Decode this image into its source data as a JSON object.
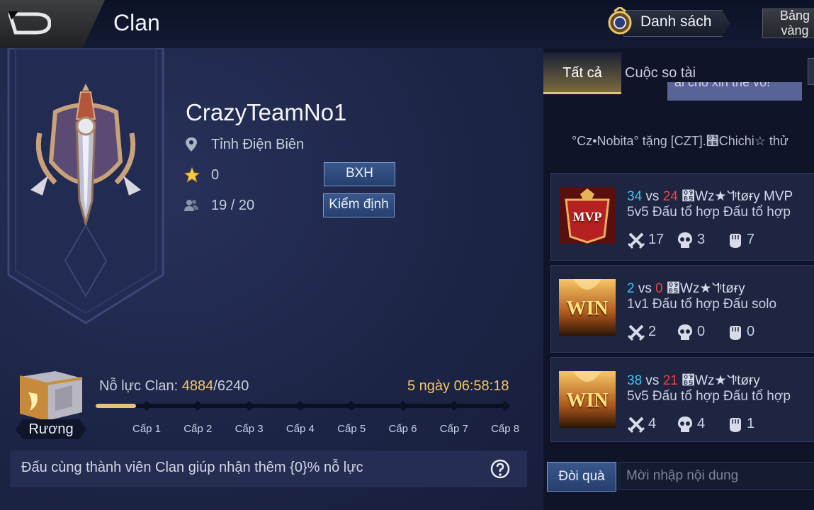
{
  "header": {
    "title": "Clan",
    "list_button": "Danh sách",
    "gold_button": "Bảng vàng"
  },
  "clan": {
    "name": "CrazyTeamNo1",
    "location": "Tỉnh Điện Biên",
    "stars": "0",
    "ranking_button": "BXH",
    "members": "19 / 20",
    "verify_button": "Kiểm định"
  },
  "progress": {
    "chest_label": "Rương",
    "effort_prefix": "Nỗ lực Clan: ",
    "effort_current": "4884",
    "effort_max": "/6240",
    "effort_fraction": 0.098,
    "timer": "5 ngày 06:58:18",
    "levels": [
      "Cấp 1",
      "Cấp 2",
      "Cấp 3",
      "Cấp 4",
      "Cấp 5",
      "Cấp 6",
      "Cấp 7",
      "Cấp 8"
    ],
    "hint": "Đấu cùng thành viên Clan giúp nhận thêm {0}% nỗ lực"
  },
  "feed": {
    "tabs": [
      "Tất cả",
      "Cuộc so tài"
    ],
    "chat_snippet": "ai cho xin thẻ vô!",
    "gift_message": "°Cz•Nobita° tặng [CZT].঵Chichi☆ thử",
    "matches": [
      {
        "badge": "MVP",
        "score_a": "34",
        "vs": " vs ",
        "score_b": "24",
        "player": " ঵Wz★ᖻᶦtøɍy MVP",
        "mode": "5v5 Đấu tổ hợp Đấu tổ hợp",
        "kills": "17",
        "deaths": "3",
        "assists": "7"
      },
      {
        "badge": "WIN",
        "score_a": "2",
        "vs": " vs ",
        "score_b": "0",
        "player": " ঵Wz★ᖻᶦtøɍy",
        "mode": "1v1 Đấu tổ hợp Đấu solo",
        "kills": "2",
        "deaths": "0",
        "assists": "0"
      },
      {
        "badge": "WIN",
        "score_a": "38",
        "vs": " vs ",
        "score_b": "21",
        "player": " ঵Wz★ᖻᶦtøɍy",
        "mode": "5v5 Đấu tổ hợp Đấu tổ hợp",
        "kills": "4",
        "deaths": "4",
        "assists": "1"
      }
    ]
  },
  "chat": {
    "gift_button": "Đòi quà",
    "placeholder": "Mời nhập nội dung"
  },
  "colors": {
    "accent_gold": "#f3c86a",
    "score_blue": "#41c6f2",
    "score_red": "#ee4343"
  }
}
